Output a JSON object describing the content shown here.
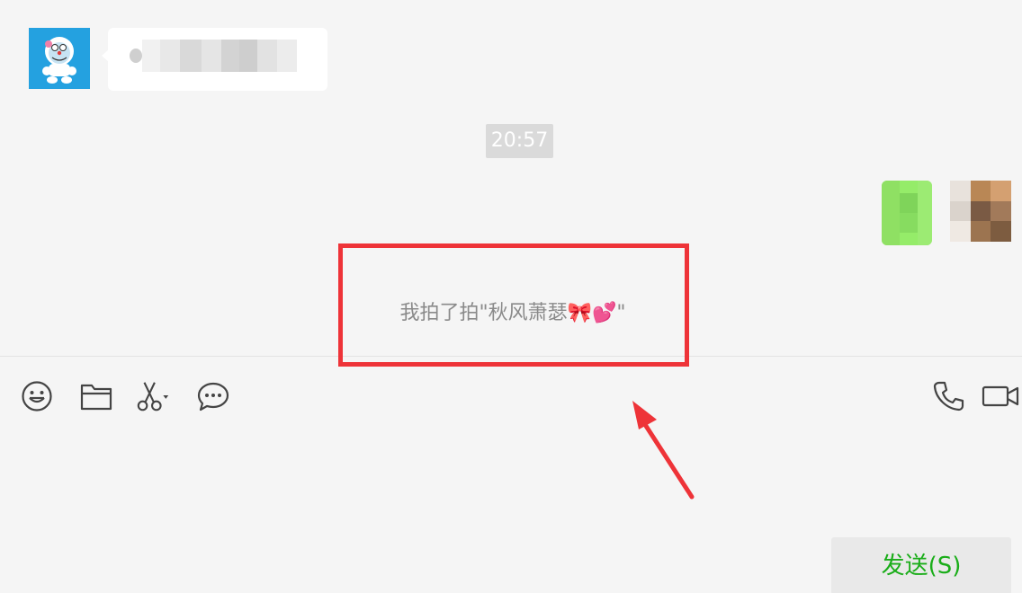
{
  "chat": {
    "timestamp": "20:57",
    "system_message": "我拍了拍\"秋风萧瑟🎀💕\""
  },
  "toolbar": {
    "left_icons": [
      "emoji-icon",
      "folder-icon",
      "scissors-icon",
      "chat-bubble-icon"
    ],
    "right_icons": [
      "phone-icon",
      "video-camera-icon"
    ]
  },
  "input": {
    "value": ""
  },
  "send_button": {
    "label": "发送(S)"
  },
  "annotation": {
    "color": "#ee3338"
  }
}
